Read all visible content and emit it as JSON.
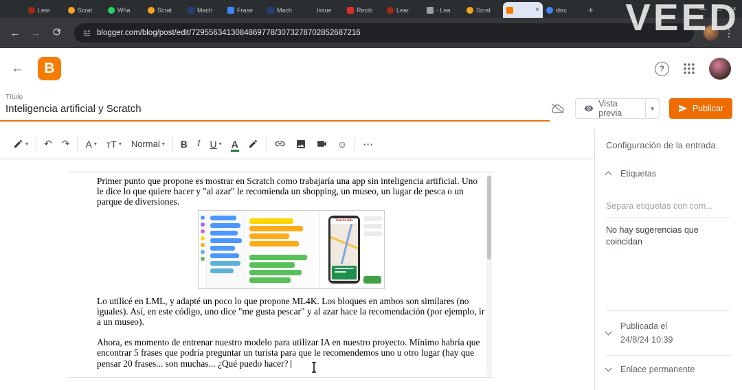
{
  "watermark": "VEED",
  "glyphs": {
    "caret": "▾",
    "undo": "↶",
    "redo": "↷",
    "emoji": "☺",
    "more": "⋯",
    "back": "←",
    "forward": "→",
    "menu": "⋮",
    "plus": "+",
    "close": "×",
    "minimize": "—",
    "maximize": "□",
    "help": "?"
  },
  "browser": {
    "url": "blogger.com/blog/post/edit/7295563413084869778/3073278702852687216",
    "tabs": [
      {
        "label": "Lear",
        "icon": "lml",
        "color": "#a52714"
      },
      {
        "label": "Scrat",
        "icon": "scratch",
        "color": "#f7a41d"
      },
      {
        "label": "Wha",
        "icon": "whatsapp",
        "color": "#25d366"
      },
      {
        "label": "Scrat",
        "icon": "scratch",
        "color": "#f7a41d"
      },
      {
        "label": "Mach",
        "icon": "ml4k",
        "color": "#273c75"
      },
      {
        "label": "Frase",
        "icon": "doc",
        "color": "#4285f4"
      },
      {
        "label": "Mach",
        "icon": "ml4k",
        "color": "#273c75"
      },
      {
        "label": "Issue",
        "icon": "issues",
        "color": "#2b3137"
      },
      {
        "label": "Recib",
        "icon": "mail",
        "color": "#d93025"
      },
      {
        "label": "Lear",
        "icon": "lml",
        "color": "#a52714"
      },
      {
        "label": "- Lea",
        "icon": "page",
        "color": "#9aa0a6"
      },
      {
        "label": "Scrat",
        "icon": "scratch",
        "color": "#f7a41d"
      },
      {
        "label": "",
        "icon": "blogger",
        "color": "#f57c00",
        "active": true
      },
      {
        "label": "disc",
        "icon": "google",
        "color": "#4285f4"
      }
    ]
  },
  "app": {
    "logo_letter": "B"
  },
  "post": {
    "title_label": "Título",
    "title_value": "Inteligencia artificial y Scratch",
    "preview_label": "Vista previa",
    "publish_label": "Publicar"
  },
  "toolbar": {
    "style_name": "Normal",
    "font_family": "A",
    "font_size": "ᴛT",
    "bold": "B",
    "italic": "I",
    "underline": "U",
    "text_color": "A"
  },
  "editor": {
    "paragraph1": "Primer punto que propone es mostrar en Scratch como trabajaría una app sin inteligencia artificial. Uno le dice lo que quiere hacer y \"al azar\" le recomienda un shopping, un museo, un lugar de pesca o un parque de diversiones.",
    "paragraph2": "Lo utilicé en LML, y adapté un poco lo que propone ML4K. Los bloques en ambos son similares (no iguales). Así, en este código, uno dice \"me gusta pescar\" y al azar hace la recomendación (por ejemplo, ir a un museo).",
    "paragraph3": "Ahora, es momento de entrenar nuestro modelo para utilizar IA en nuestro proyecto. Mínimo habría que encontrar 5 frases que podría preguntar un turista para que le recomendemos uno u otro lugar (hay que pensar 20 frases... son muchas... ¿Qué puedo hacer?",
    "image": {
      "phone_title": "Tourist Info"
    }
  },
  "sidebar": {
    "heading": "Configuración de la entrada",
    "labels_label": "Etiquetas",
    "labels_placeholder": "Separa etiquetas con com...",
    "no_suggestions": "No hay sugerencias que coincidan",
    "published_label": "Publicada el",
    "published_date": "24/8/24 10:39",
    "permalink_label": "Enlace permanente"
  }
}
